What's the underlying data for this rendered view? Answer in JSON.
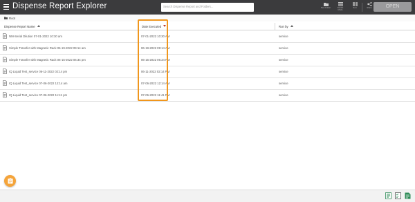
{
  "header": {
    "title": "Dispense Report Explorer",
    "search_placeholder": "Search Dispense Report and Folders...",
    "toolbar": [
      {
        "label": "New Folder",
        "icon": "new-folder-icon"
      },
      {
        "label": "Details Mode",
        "icon": "details-icon"
      },
      {
        "label": "Sort",
        "icon": "sort-icon"
      },
      {
        "label": "Share",
        "icon": "share-icon"
      },
      {
        "label": "Info",
        "icon": "info-icon"
      }
    ],
    "open_label": "OPEN"
  },
  "breadcrumb": {
    "label": "Root"
  },
  "table": {
    "columns": [
      {
        "label": "Dispense Report Name",
        "sort": "asc"
      },
      {
        "label": "Date Executed",
        "sort": "desc"
      },
      {
        "label": "Run by",
        "sort": "asc"
      }
    ],
    "rows": [
      {
        "name": "NM-Serial Dilution 07-01-2022 10:30 am",
        "date": "07-01-2022 10:30 AM",
        "run_by": "service"
      },
      {
        "name": "Simple Transfer with Magnetic Rack 06-19-2022 09:14 am",
        "date": "06-19-2022 09:14 AM",
        "run_by": "service"
      },
      {
        "name": "Simple Transfer with Magnetic Rack 06-15-2022 06:34 pm",
        "date": "06-15-2022 06:34 PM",
        "run_by": "service"
      },
      {
        "name": "IQ Liquid Test_service 06-11-2022 02:14 pm",
        "date": "06-11-2022 02:14 PM",
        "run_by": "service"
      },
      {
        "name": "IQ Liquid Test_service 07-06-2022 12:14 am",
        "date": "07-06-2022 12:14 AM",
        "run_by": "service"
      },
      {
        "name": "IQ Liquid Test_service 07-06-2022 11:41 pm",
        "date": "07-06-2022 11:41 PM",
        "run_by": "service"
      }
    ]
  },
  "fab": {
    "icon": "clipboard-icon"
  },
  "bottombar": {
    "icons": [
      "report-green-icon",
      "checklist-icon",
      "document-green-icon"
    ]
  },
  "colors": {
    "header_bg": "#3b3b3d",
    "highlight": "#f0961c",
    "fab": "#f5a43a",
    "accent_green": "#2e8b57"
  }
}
